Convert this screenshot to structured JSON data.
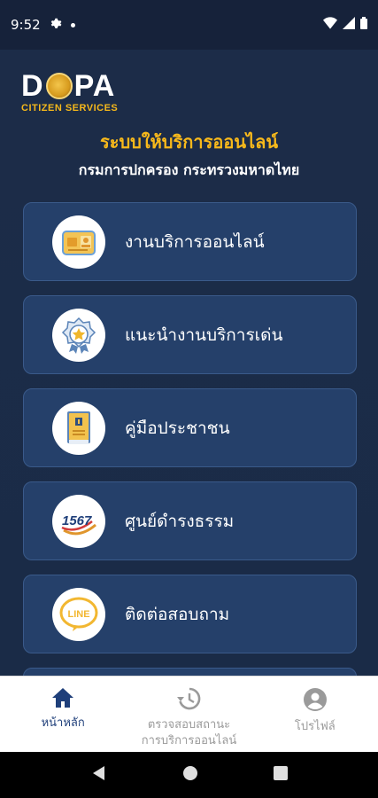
{
  "status": {
    "time": "9:52"
  },
  "logo": {
    "word_left": "D",
    "word_right": "PA",
    "sub": "CITIZEN SERVICES"
  },
  "header": {
    "title": "ระบบให้บริการออนไลน์",
    "subtitle": "กรมการปกครอง กระทรวงมหาดไทย"
  },
  "menu": {
    "items": [
      {
        "label": "งานบริการออนไลน์",
        "icon": "id-card-icon"
      },
      {
        "label": "แนะนำงานบริการเด่น",
        "icon": "award-badge-icon"
      },
      {
        "label": "คู่มือประชาชน",
        "icon": "manual-book-icon"
      },
      {
        "label": "ศูนย์ดำรงธรรม",
        "icon": "hotline-1567-icon"
      },
      {
        "label": "ติดต่อสอบถาม",
        "icon": "line-chat-icon"
      }
    ],
    "hotline_text": "1567",
    "line_text": "LINE"
  },
  "bottom_nav": {
    "home": "หน้าหลัก",
    "status_line1": "ตรวจสอบสถานะ",
    "status_line2": "การบริการออนไลน์",
    "profile": "โปรไฟล์"
  },
  "colors": {
    "accent": "#f8b91b",
    "primary": "#1f3f7a",
    "card": "#25406a"
  }
}
